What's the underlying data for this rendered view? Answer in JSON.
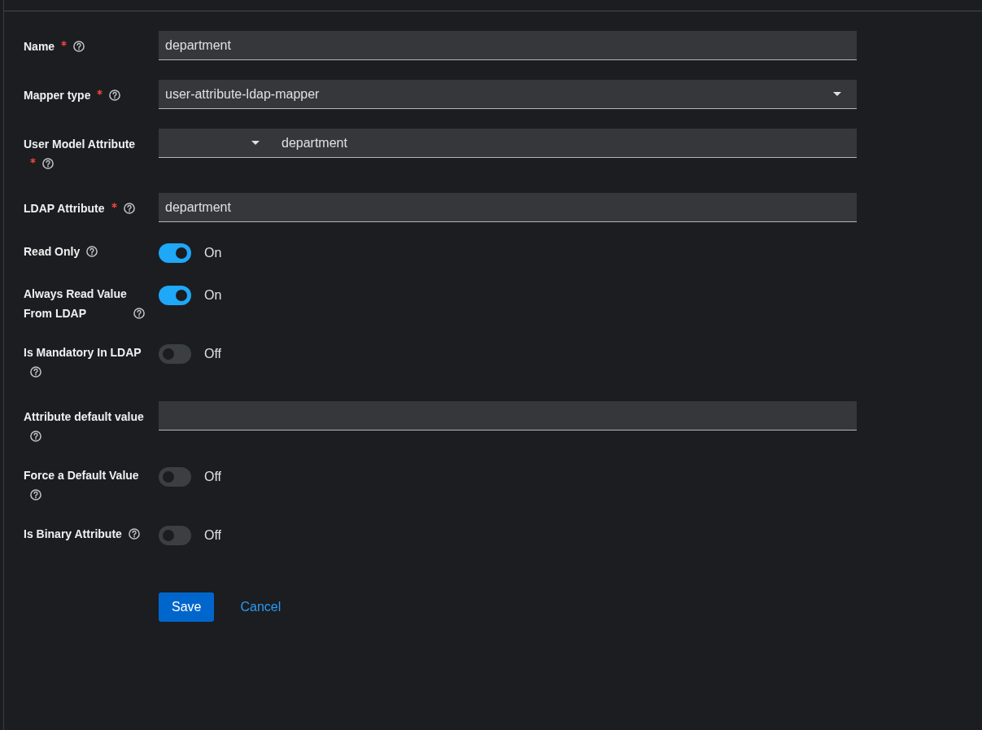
{
  "fields": [
    {
      "kind": "text",
      "label": "Name",
      "required": true,
      "value": "department"
    },
    {
      "kind": "select",
      "label": "Mapper type",
      "required": true,
      "value": "user-attribute-ldap-mapper"
    },
    {
      "kind": "select-text",
      "label": "User Model Attribute",
      "required": true,
      "value": "department"
    },
    {
      "kind": "text",
      "label": "LDAP Attribute",
      "required": true,
      "value": "department"
    },
    {
      "kind": "switch",
      "label": "Read Only",
      "required": false,
      "on": true,
      "state_text": "On"
    },
    {
      "kind": "switch",
      "label": "Always Read Value From LDAP",
      "required": false,
      "on": true,
      "state_text": "On"
    },
    {
      "kind": "switch",
      "label": "Is Mandatory In LDAP",
      "required": false,
      "on": false,
      "state_text": "Off"
    },
    {
      "kind": "text",
      "label": "Attribute default value",
      "required": false
    },
    {
      "kind": "switch",
      "label": "Force a Default Value",
      "required": false,
      "on": false,
      "state_text": "Off"
    },
    {
      "kind": "switch",
      "label": "Is Binary Attribute",
      "required": false,
      "on": false,
      "state_text": "Off"
    }
  ],
  "actions": {
    "save": "Save",
    "cancel": "Cancel"
  }
}
